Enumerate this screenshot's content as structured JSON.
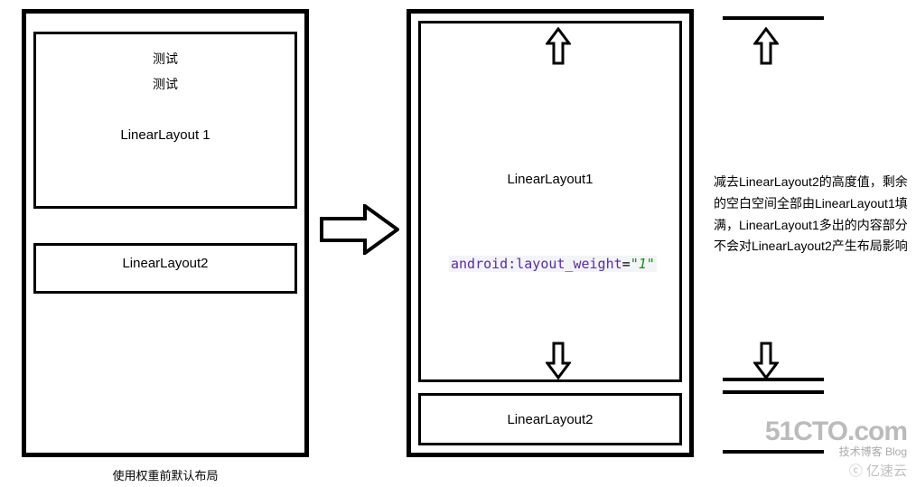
{
  "left_phone": {
    "test_line_1": "测试",
    "test_line_2": "测试",
    "linearlayout1": "LinearLayout 1",
    "linearlayout2": "LinearLayout2"
  },
  "left_caption": "使用权重前默认布局",
  "right_phone": {
    "linearlayout1": "LinearLayout1",
    "code_attr": "android:layout_weight",
    "code_eq": "=",
    "code_val": "\"1\"",
    "linearlayout2": "LinearLayout2"
  },
  "right_explanation": "减去LinearLayout2的高度值，剩余的空白空间全部由LinearLayout1填满，LinearLayout1多出的内容部分不会对LinearLayout2产生布局影响",
  "watermark": {
    "main": "51CTO.com",
    "sub": "技术博客  Blog",
    "yisu": "ⓒ 亿速云"
  }
}
